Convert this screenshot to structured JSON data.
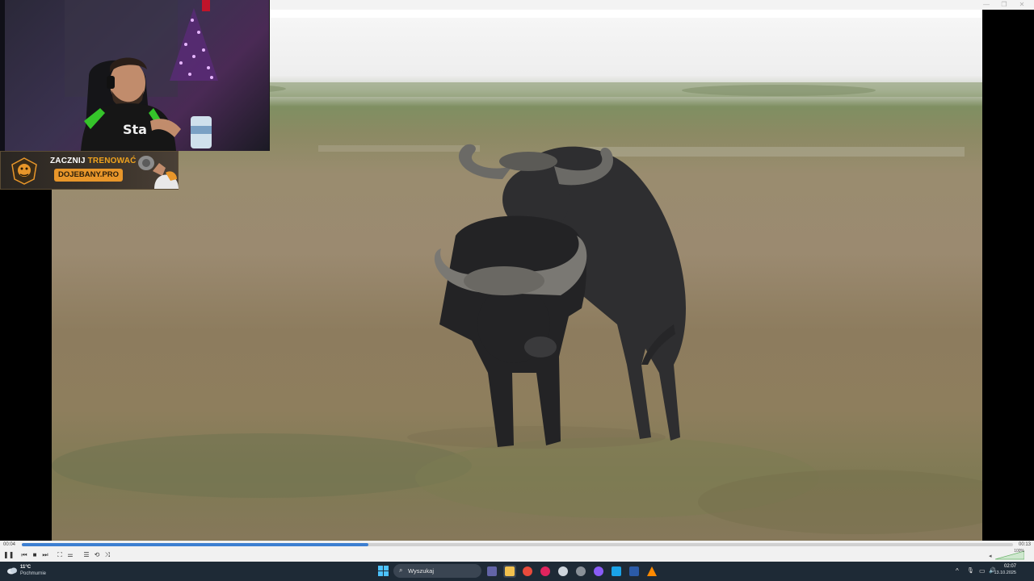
{
  "window": {
    "min_glyph": "—",
    "max_glyph": "❐",
    "close_glyph": "✕"
  },
  "ad": {
    "line1_a": "ZACZNIJ ",
    "line1_b": "TRENOWAĆ",
    "url": "DOJEBANY.PRO"
  },
  "player": {
    "current_time": "00:04",
    "total_time": "00:13",
    "progress_fraction": 0.35,
    "volume_label": "100%",
    "buttons": {
      "play_pause": "❚❚",
      "prev": "⏮",
      "stop": "■",
      "next": "⏭",
      "fullscreen": "⛶",
      "extended": "⚌",
      "playlist": "☰",
      "loop": "⟲",
      "shuffle": "⤨"
    }
  },
  "taskbar": {
    "temperature": "11°C",
    "condition": "Pochmurnie",
    "search_placeholder": "Wyszukaj",
    "search_icon": "⌕",
    "time": "02:07",
    "date": "13.10.2025",
    "tray": {
      "chevron": "^",
      "mic": "🎙",
      "network": "▭",
      "volume": "🔊"
    },
    "apps": [
      {
        "name": "teams-icon",
        "color": "#6264a7"
      },
      {
        "name": "file-explorer-icon",
        "color": "#f2c14e"
      },
      {
        "name": "chrome-icon",
        "color": "#e94b3c"
      },
      {
        "name": "opera-icon",
        "color": "#e0245e"
      },
      {
        "name": "steam-icon",
        "color": "#cfd6dd"
      },
      {
        "name": "xbox-icon",
        "color": "#8a9199"
      },
      {
        "name": "messenger-icon",
        "color": "#8a5cf6"
      },
      {
        "name": "store-icon",
        "color": "#1aa3e8"
      },
      {
        "name": "lightroom-icon",
        "color": "#2b5ba8"
      },
      {
        "name": "vlc-icon",
        "color": "#ff8a00"
      }
    ]
  }
}
